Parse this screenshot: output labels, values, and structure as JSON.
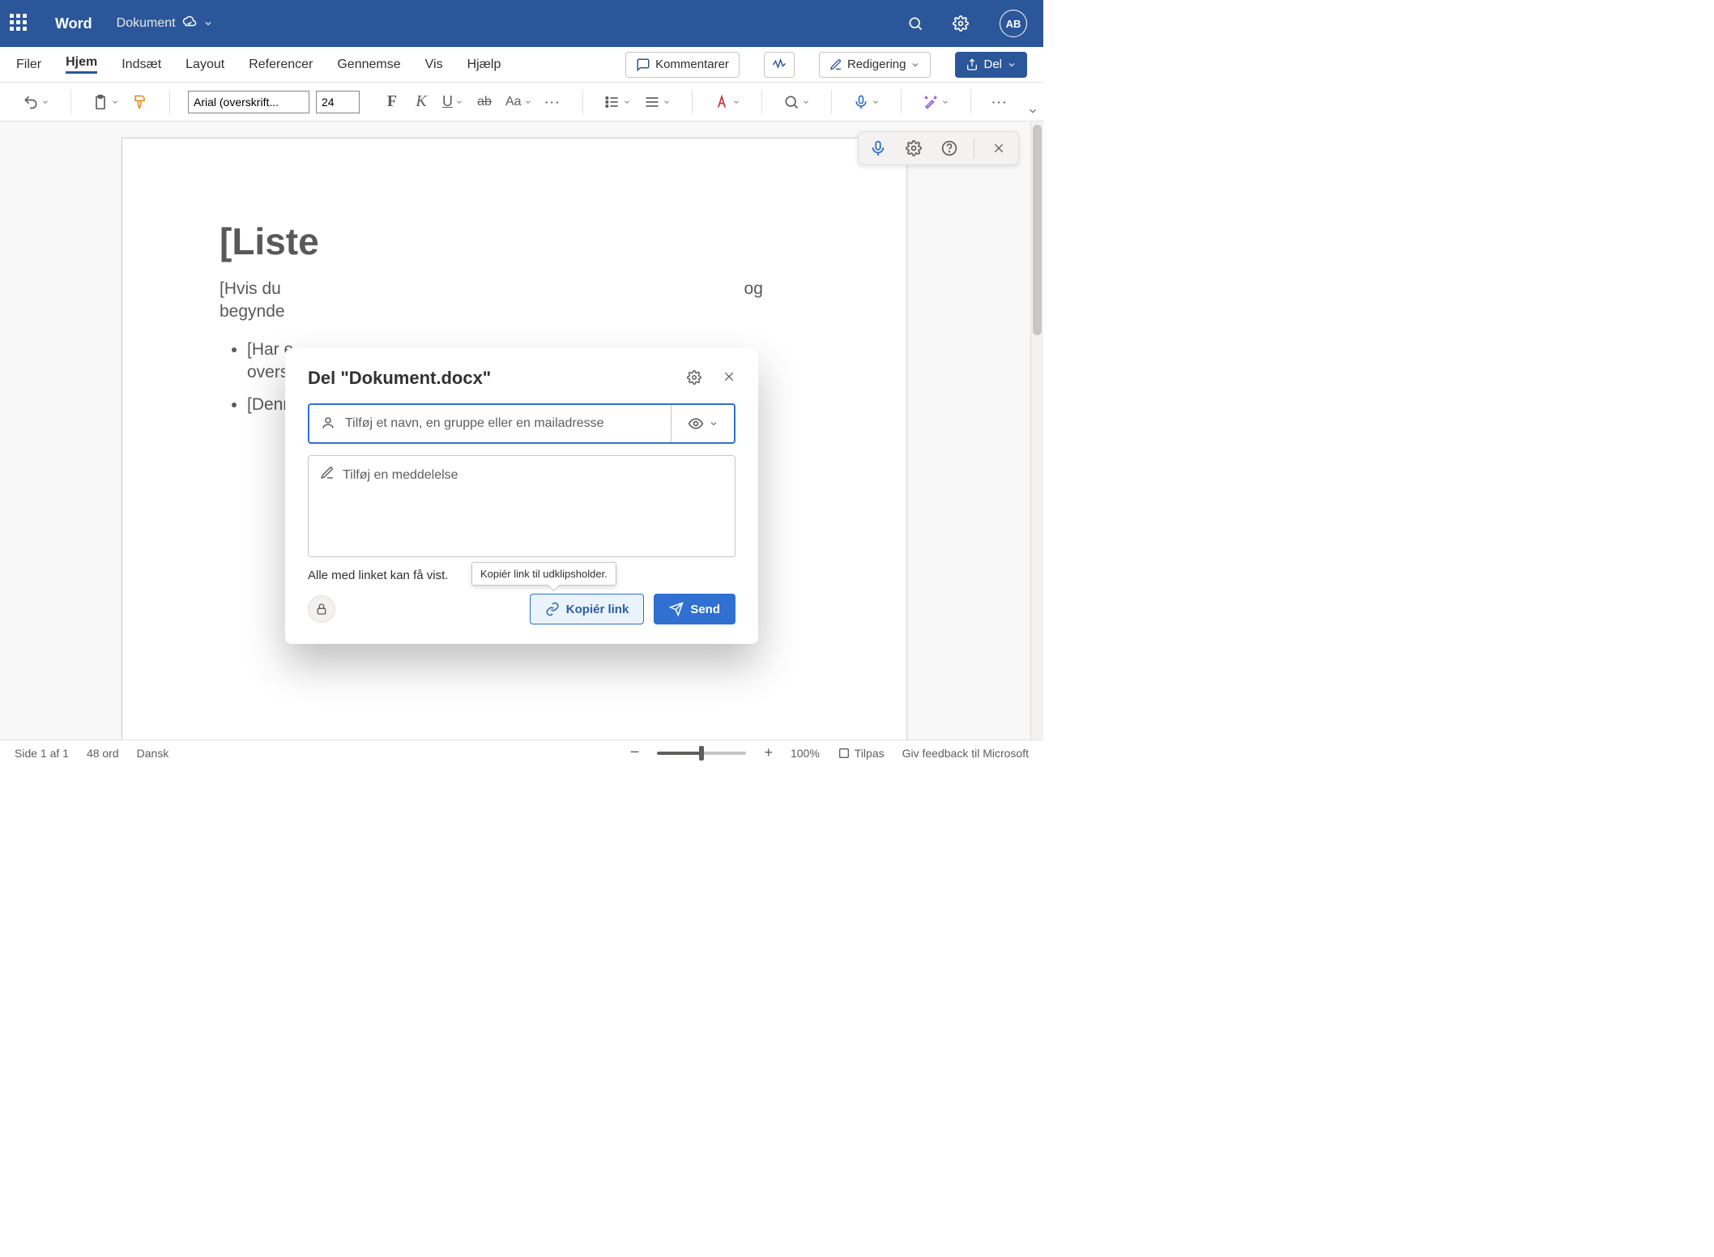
{
  "titlebar": {
    "app_name": "Word",
    "document_name": "Dokument",
    "avatar_initials": "AB"
  },
  "ribbon": {
    "tabs": [
      "Filer",
      "Hjem",
      "Indsæt",
      "Layout",
      "Referencer",
      "Gennemse",
      "Vis",
      "Hjælp"
    ],
    "active_tab_index": 1,
    "buttons": {
      "comments": "Kommentarer",
      "editing": "Redigering",
      "share": "Del"
    },
    "font_name": "Arial (overskrift...",
    "font_size": "24",
    "case_label": "Aa"
  },
  "document": {
    "heading": "[Liste",
    "paragraph_fragment_1": "[Hvis du",
    "paragraph_fragment_2": "og",
    "paragraph_fragment_3": "begynde",
    "bullets": [
      {
        "line1": "[Har e",
        "line2": "overs"
      },
      {
        "line1": "[Denn"
      }
    ]
  },
  "share_dialog": {
    "title": "Del \"Dokument.docx\"",
    "name_placeholder": "Tilføj et navn, en gruppe eller en mailadresse",
    "message_placeholder": "Tilføj en meddelelse",
    "link_note": "Alle med linket kan få vist.",
    "copy_link": "Kopiér link",
    "send": "Send",
    "tooltip": "Kopiér link til udklipsholder."
  },
  "statusbar": {
    "page": "Side 1 af 1",
    "word_count": "48 ord",
    "language": "Dansk",
    "zoom": "100%",
    "fit": "Tilpas",
    "feedback": "Giv feedback til Microsoft"
  }
}
